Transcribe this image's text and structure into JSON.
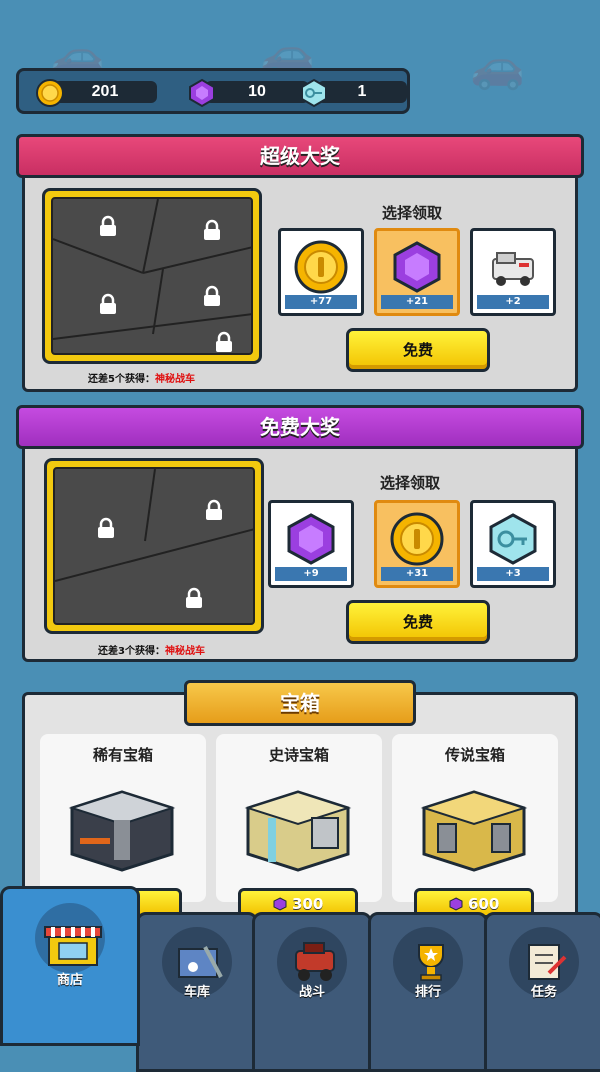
{
  "currency": {
    "coins": "201",
    "gems": "10",
    "keys": "1"
  },
  "super_prize": {
    "title": "超级大奖",
    "progress_prefix": "还差5个获得：",
    "progress_reward": "神秘战车",
    "choose_label": "选择领取",
    "options": [
      {
        "icon": "gold-coin-icon",
        "count": "+77"
      },
      {
        "icon": "purple-gem-icon",
        "count": "+21"
      },
      {
        "icon": "armored-car-icon",
        "count": "+2"
      }
    ],
    "free_button": "免费"
  },
  "free_prize": {
    "title": "免费大奖",
    "progress_prefix": "还差3个获得：",
    "progress_reward": "神秘战车",
    "choose_label": "选择领取",
    "options": [
      {
        "icon": "purple-gem-icon",
        "count": "+9"
      },
      {
        "icon": "gold-coin-icon",
        "count": "+31"
      },
      {
        "icon": "key-icon",
        "count": "+3"
      }
    ],
    "free_button": "免费"
  },
  "chests": {
    "title": "宝箱",
    "items": [
      {
        "name": "稀有宝箱",
        "price": ""
      },
      {
        "name": "史诗宝箱",
        "price": "300"
      },
      {
        "name": "传说宝箱",
        "price": "600"
      }
    ]
  },
  "nav": {
    "tabs": [
      {
        "label": "商店",
        "icon": "shop-icon"
      },
      {
        "label": "车库",
        "icon": "garage-icon"
      },
      {
        "label": "战斗",
        "icon": "battle-car-icon"
      },
      {
        "label": "排行",
        "icon": "trophy-icon"
      },
      {
        "label": "任务",
        "icon": "task-list-icon"
      }
    ]
  },
  "colors": {
    "background": "#4a8fb5",
    "super_ribbon": "#d63b6e",
    "free_ribbon": "#b03fd0",
    "button_yellow": "#f7d51a",
    "nav_active": "#3a8fd0",
    "nav_inactive": "#3f5a79"
  }
}
